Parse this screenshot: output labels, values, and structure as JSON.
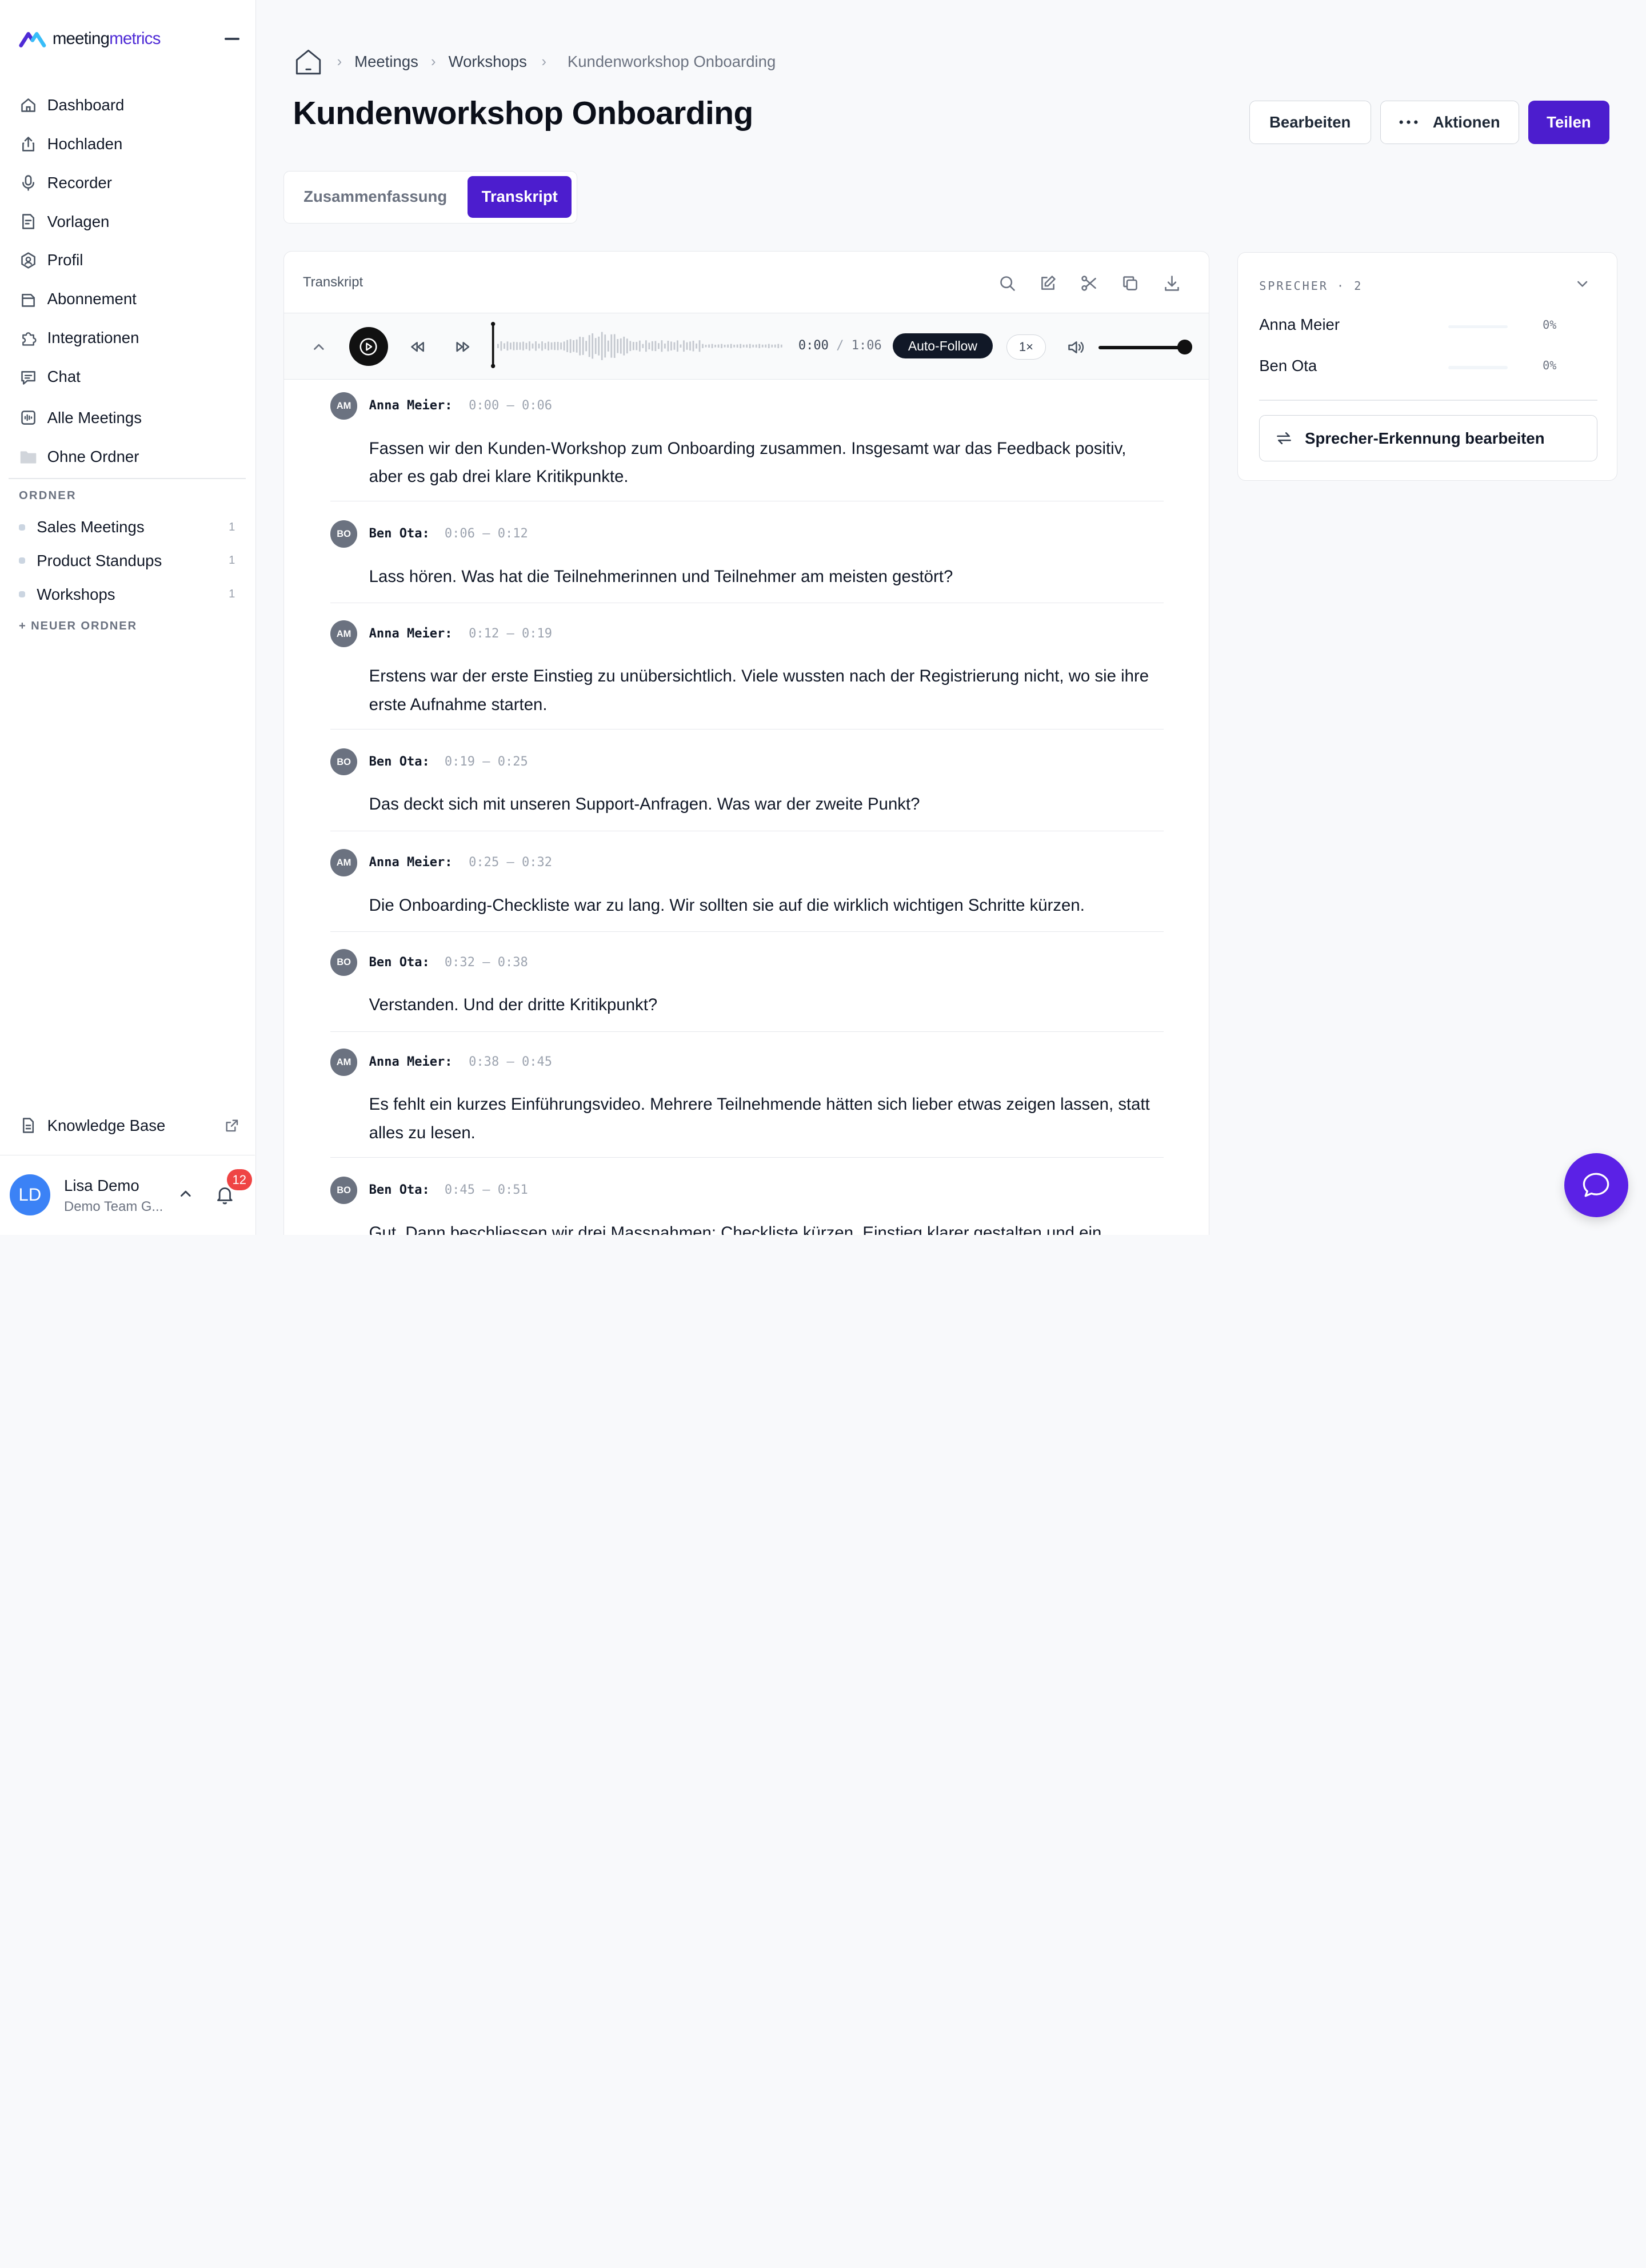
{
  "app": {
    "logo_part1": "meeting",
    "logo_part2": "metrics"
  },
  "sidebar": {
    "nav": [
      {
        "label": "Dashboard",
        "icon": "home-icon"
      },
      {
        "label": "Hochladen",
        "icon": "upload-icon"
      },
      {
        "label": "Recorder",
        "icon": "microphone-icon"
      },
      {
        "label": "Vorlagen",
        "icon": "template-icon"
      },
      {
        "label": "Profil",
        "icon": "profile-icon"
      },
      {
        "label": "Abonnement",
        "icon": "subscription-icon"
      },
      {
        "label": "Integrationen",
        "icon": "puzzle-icon"
      },
      {
        "label": "Chat",
        "icon": "chat-icon"
      },
      {
        "label": "Alle Meetings",
        "icon": "audio-file-icon"
      },
      {
        "label": "Ohne Ordner",
        "icon": "folder-icon"
      }
    ],
    "folders_heading": "ORDNER",
    "folders": [
      {
        "label": "Sales Meetings",
        "count": "1"
      },
      {
        "label": "Product Standups",
        "count": "1"
      },
      {
        "label": "Workshops",
        "count": "1"
      }
    ],
    "new_folder": "+ NEUER ORDNER",
    "knowledge_base": "Knowledge Base",
    "user": {
      "initials": "LD",
      "name": "Lisa Demo",
      "team": "Demo Team G...",
      "notifications": "12"
    }
  },
  "breadcrumb": {
    "items": [
      "Meetings",
      "Workshops"
    ],
    "current": "Kundenworkshop Onboarding"
  },
  "header": {
    "title": "Kundenworkshop Onboarding",
    "edit": "Bearbeiten",
    "actions": "Aktionen",
    "share": "Teilen"
  },
  "tabs": {
    "summary": "Zusammenfassung",
    "transcript": "Transkript"
  },
  "transcript": {
    "title": "Transkript",
    "player": {
      "current": "0:00",
      "sep": "/",
      "duration": "1:06",
      "autofollow": "Auto-Follow",
      "speed": "1×",
      "volume": 1.0
    },
    "segments": [
      {
        "initials": "AM",
        "speaker": "Anna Meier:",
        "time": "0:00 — 0:06",
        "text": "Fassen wir den Kunden-Workshop zum Onboarding zusammen. Insgesamt war das Feedback positiv, aber es gab drei klare Kritikpunkte."
      },
      {
        "initials": "BO",
        "speaker": "Ben Ota:",
        "time": "0:06 — 0:12",
        "text": "Lass hören. Was hat die Teilnehmerinnen und Teilnehmer am meisten gestört?"
      },
      {
        "initials": "AM",
        "speaker": "Anna Meier:",
        "time": "0:12 — 0:19",
        "text": "Erstens war der erste Einstieg zu unübersichtlich. Viele wussten nach der Registrierung nicht, wo sie ihre erste Aufnahme starten."
      },
      {
        "initials": "BO",
        "speaker": "Ben Ota:",
        "time": "0:19 — 0:25",
        "text": "Das deckt sich mit unseren Support-Anfragen. Was war der zweite Punkt?"
      },
      {
        "initials": "AM",
        "speaker": "Anna Meier:",
        "time": "0:25 — 0:32",
        "text": "Die Onboarding-Checkliste war zu lang. Wir sollten sie auf die wirklich wichtigen Schritte kürzen."
      },
      {
        "initials": "BO",
        "speaker": "Ben Ota:",
        "time": "0:32 — 0:38",
        "text": "Verstanden. Und der dritte Kritikpunkt?"
      },
      {
        "initials": "AM",
        "speaker": "Anna Meier:",
        "time": "0:38 — 0:45",
        "text": "Es fehlt ein kurzes Einführungsvideo. Mehrere Teilnehmende hätten sich lieber etwas zeigen lassen, statt alles zu lesen."
      },
      {
        "initials": "BO",
        "speaker": "Ben Ota:",
        "time": "0:45 — 0:51",
        "text": "Gut. Dann beschliessen wir drei Massnahmen: Checkliste kürzen, Einstieg klarer gestalten und ein"
      }
    ]
  },
  "speakers": {
    "heading": "SPRECHER · 2",
    "list": [
      {
        "name": "Anna Meier",
        "pct": "0%"
      },
      {
        "name": "Ben Ota",
        "pct": "0%"
      }
    ],
    "edit_button": "Sprecher-Erkennung bearbeiten"
  },
  "colors": {
    "brand": "#4c1dce",
    "chat_fab": "#5b21e6",
    "badge": "#ef4444",
    "avatar": "#3b82f6"
  }
}
